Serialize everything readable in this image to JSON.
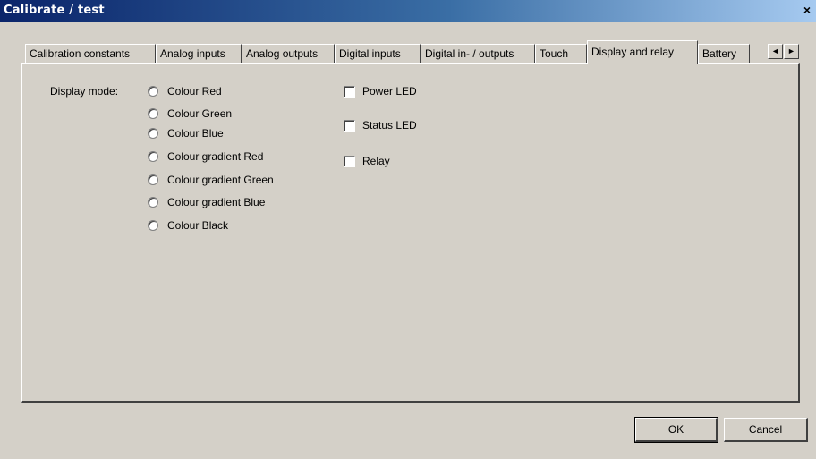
{
  "window": {
    "title": "Calibrate / test",
    "close_glyph": "×"
  },
  "tabs": [
    {
      "label": "Calibration constants",
      "selected": false
    },
    {
      "label": "Analog inputs",
      "selected": false
    },
    {
      "label": "Analog outputs",
      "selected": false
    },
    {
      "label": "Digital inputs",
      "selected": false
    },
    {
      "label": "Digital in- / outputs",
      "selected": false
    },
    {
      "label": "Touch",
      "selected": false
    },
    {
      "label": "Display and relay",
      "selected": true
    },
    {
      "label": "Battery",
      "selected": false
    }
  ],
  "tab_scroll": {
    "left_glyph": "◄",
    "right_glyph": "►"
  },
  "display": {
    "mode_label": "Display mode:",
    "options": [
      {
        "label": "Colour Red",
        "checked": false
      },
      {
        "label": "Colour Green",
        "checked": false
      },
      {
        "label": "Colour Blue",
        "checked": false
      },
      {
        "label": "Colour gradient Red",
        "checked": false
      },
      {
        "label": "Colour gradient Green",
        "checked": false
      },
      {
        "label": "Colour gradient Blue",
        "checked": false
      },
      {
        "label": "Colour Black",
        "checked": false
      }
    ]
  },
  "checks": [
    {
      "label": "Power LED",
      "checked": false
    },
    {
      "label": "Status LED",
      "checked": false
    },
    {
      "label": "Relay",
      "checked": false
    }
  ],
  "buttons": {
    "ok": "OK",
    "cancel": "Cancel"
  }
}
